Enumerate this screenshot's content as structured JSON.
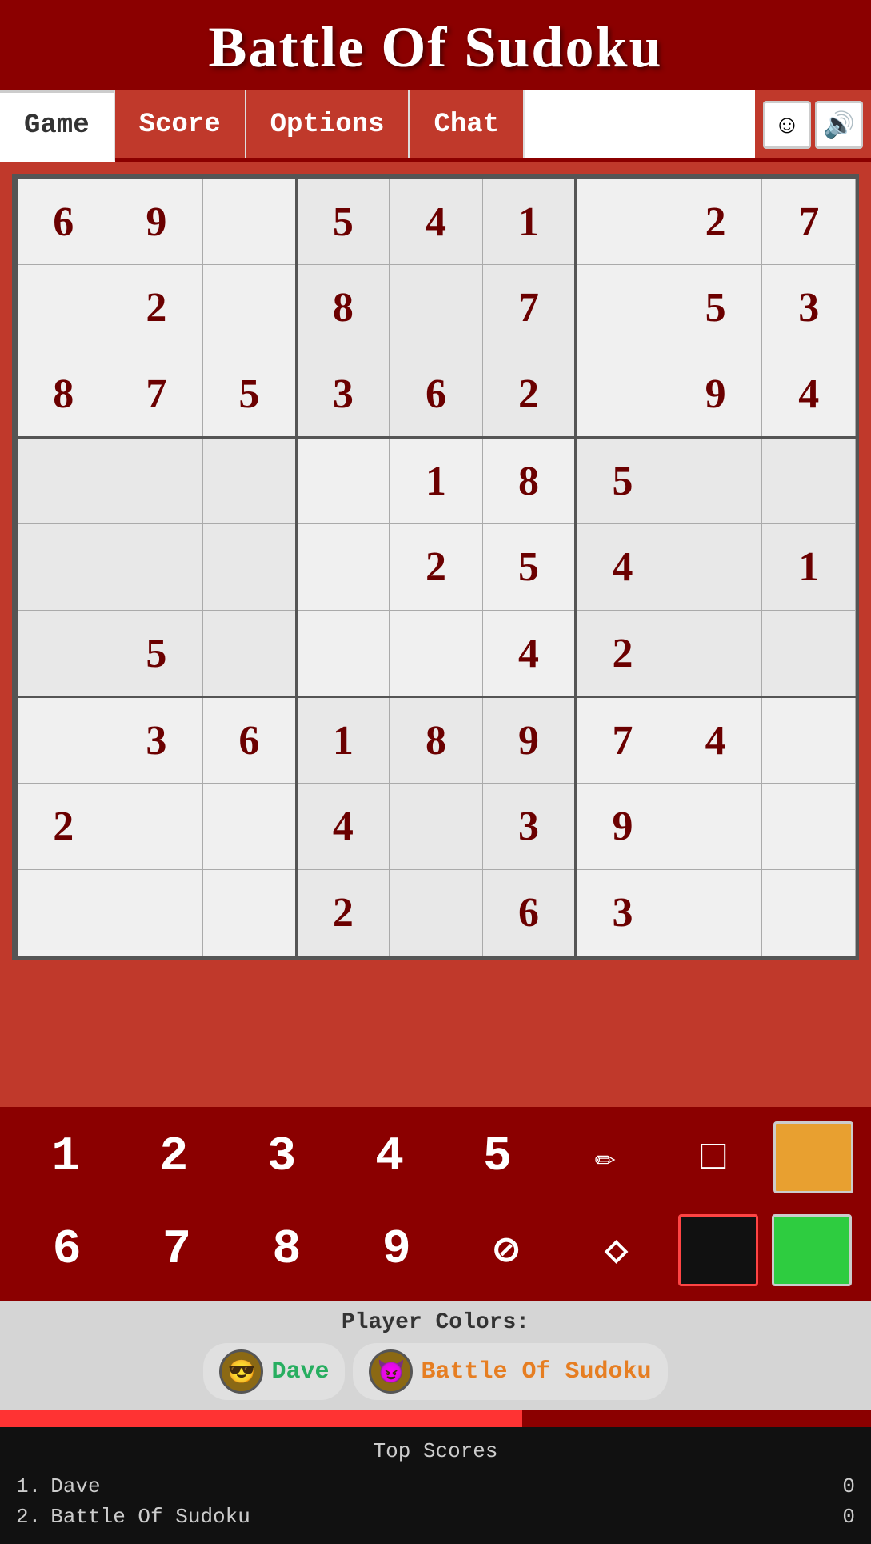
{
  "header": {
    "title": "Battle Of Sudoku"
  },
  "nav": {
    "tabs": [
      {
        "label": "Game",
        "active": true
      },
      {
        "label": "Score",
        "active": false
      },
      {
        "label": "Options",
        "active": false
      },
      {
        "label": "Chat",
        "active": false
      }
    ],
    "smiley_icon": "☺",
    "sound_icon": "🔊"
  },
  "grid": {
    "rows": [
      [
        "6",
        "9",
        "",
        "5",
        "4",
        "1",
        "",
        "2",
        "7"
      ],
      [
        "",
        "2",
        "",
        "8",
        "",
        "7",
        "",
        "5",
        "3"
      ],
      [
        "8",
        "7",
        "5",
        "3",
        "6",
        "2",
        "",
        "9",
        "4"
      ],
      [
        "",
        "",
        "",
        "",
        "1",
        "8",
        "5",
        "",
        ""
      ],
      [
        "",
        "",
        "",
        "",
        "2",
        "5",
        "4",
        "",
        "1"
      ],
      [
        "",
        "5",
        "",
        "",
        "",
        "4",
        "2",
        "",
        ""
      ],
      [
        "",
        "3",
        "6",
        "1",
        "8",
        "9",
        "7",
        "4",
        ""
      ],
      [
        "2",
        "",
        "",
        "4",
        "",
        "3",
        "9",
        "",
        ""
      ],
      [
        "",
        "",
        "",
        "2",
        "",
        "6",
        "3",
        "",
        ""
      ]
    ]
  },
  "numpad": {
    "row1": [
      "1",
      "2",
      "3",
      "4",
      "5",
      "✏",
      "□",
      ""
    ],
    "row2": [
      "6",
      "7",
      "8",
      "9",
      "⊘",
      "◇",
      "",
      ""
    ],
    "orange_swatch": "orange",
    "black_swatch": "black",
    "green_swatch": "green"
  },
  "player_colors": {
    "label": "Player Colors:",
    "players": [
      {
        "name": "Dave",
        "color": "green",
        "avatar": "😎"
      },
      {
        "name": "Battle Of Sudoku",
        "color": "orange",
        "avatar": "😈"
      }
    ]
  },
  "scores": {
    "title": "Top Scores",
    "entries": [
      {
        "rank": "1.",
        "name": "Dave",
        "score": "0"
      },
      {
        "rank": "2.",
        "name": "Battle Of Sudoku",
        "score": "0"
      }
    ]
  }
}
